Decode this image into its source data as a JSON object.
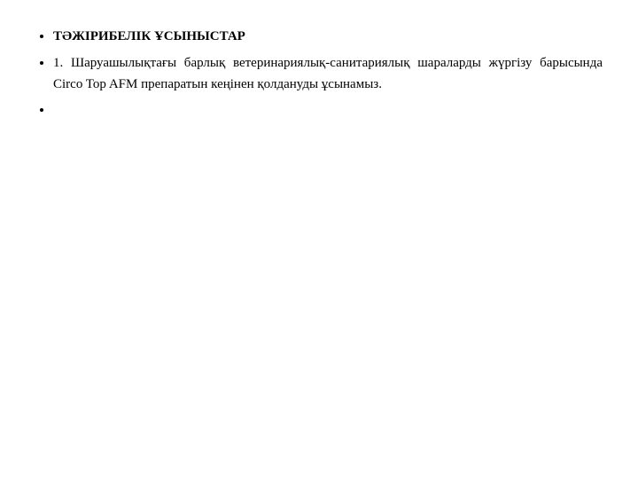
{
  "content": {
    "heading": "ТӘЖІРИБЕЛІК ҰСЫНЫСТАР",
    "paragraph": "1. Шаруашылықтағы барлық ветеринариялық-санитариялық шараларды жүргізу барысында Circo Top AFM препаратын кеңінен қолдануды ұсынамыз."
  }
}
